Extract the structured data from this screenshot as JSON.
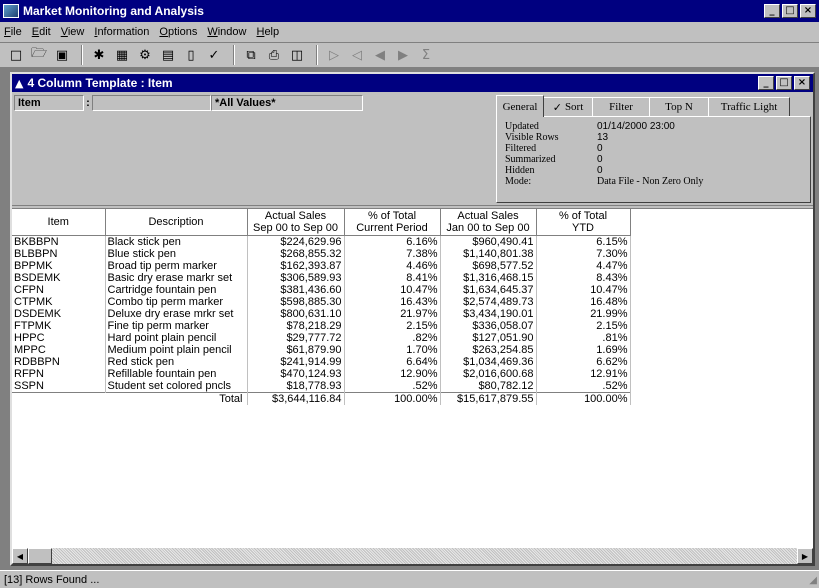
{
  "window": {
    "title": "Market Monitoring and Analysis",
    "minimize": "_",
    "maximize": "□",
    "close": "×"
  },
  "menu": [
    "File",
    "Edit",
    "View",
    "Information",
    "Options",
    "Window",
    "Help"
  ],
  "toolbar": {
    "icons": [
      "new-icon",
      "open-icon",
      "save-icon",
      "runner-icon",
      "hierarchy-icon",
      "db-icon",
      "table-icon",
      "chart-icon",
      "check-icon",
      "copy-icon",
      "print-icon",
      "export-icon",
      "play-icon",
      "first-icon",
      "prev-icon",
      "next-icon",
      "sum-icon"
    ]
  },
  "child": {
    "title": "4 Column Template : Item",
    "filter": {
      "label": "Item",
      "colon": ":",
      "value": "",
      "all_values": "*All Values*"
    },
    "tabs": [
      "General",
      "Sort",
      "Filter",
      "Top N",
      "Traffic Light"
    ],
    "info": {
      "updated_label": "Updated",
      "updated_value": "01/14/2000 23:00",
      "visible_label": "Visible Rows",
      "visible_value": "13",
      "filtered_label": "Filtered",
      "filtered_value": "0",
      "summarized_label": "Summarized",
      "summarized_value": "0",
      "hidden_label": "Hidden",
      "hidden_value": "0",
      "mode_label": "Mode:",
      "mode_value": "Data File - Non Zero Only"
    }
  },
  "table": {
    "headers": [
      {
        "l1": "Item",
        "l2": ""
      },
      {
        "l1": "Description",
        "l2": ""
      },
      {
        "l1": "Actual Sales",
        "l2": "Sep 00 to Sep 00"
      },
      {
        "l1": "% of Total",
        "l2": "Current Period"
      },
      {
        "l1": "Actual Sales",
        "l2": "Jan 00 to Sep 00"
      },
      {
        "l1": "% of Total",
        "l2": "YTD"
      }
    ],
    "rows": [
      [
        "BKBBPN",
        "Black stick pen",
        "$224,629.96",
        "6.16%",
        "$960,490.41",
        "6.15%"
      ],
      [
        "BLBBPN",
        "Blue stick pen",
        "$268,855.32",
        "7.38%",
        "$1,140,801.38",
        "7.30%"
      ],
      [
        "BPPMK",
        "Broad tip perm marker",
        "$162,393.87",
        "4.46%",
        "$698,577.52",
        "4.47%"
      ],
      [
        "BSDEMK",
        "Basic dry erase markr set",
        "$306,589.93",
        "8.41%",
        "$1,316,468.15",
        "8.43%"
      ],
      [
        "CFPN",
        "Cartridge fountain pen",
        "$381,436.60",
        "10.47%",
        "$1,634,645.37",
        "10.47%"
      ],
      [
        "CTPMK",
        "Combo tip perm marker",
        "$598,885.30",
        "16.43%",
        "$2,574,489.73",
        "16.48%"
      ],
      [
        "DSDEMK",
        "Deluxe dry erase mrkr set",
        "$800,631.10",
        "21.97%",
        "$3,434,190.01",
        "21.99%"
      ],
      [
        "FTPMK",
        "Fine tip perm marker",
        "$78,218.29",
        "2.15%",
        "$336,058.07",
        "2.15%"
      ],
      [
        "HPPC",
        "Hard point plain pencil",
        "$29,777.72",
        ".82%",
        "$127,051.90",
        ".81%"
      ],
      [
        "MPPC",
        "Medium point plain pencil",
        "$61,879.90",
        "1.70%",
        "$263,254.85",
        "1.69%"
      ],
      [
        "RDBBPN",
        "Red stick pen",
        "$241,914.99",
        "6.64%",
        "$1,034,469.36",
        "6.62%"
      ],
      [
        "RFPN",
        "Refillable fountain pen",
        "$470,124.93",
        "12.90%",
        "$2,016,600.68",
        "12.91%"
      ],
      [
        "SSPN",
        "Student set colored pncls",
        "$18,778.93",
        ".52%",
        "$80,782.12",
        ".52%"
      ]
    ],
    "total": {
      "label": "Total",
      "a": "$3,644,116.84",
      "b": "100.00%",
      "c": "$15,617,879.55",
      "d": "100.00%"
    }
  },
  "status": "[13] Rows Found ..."
}
